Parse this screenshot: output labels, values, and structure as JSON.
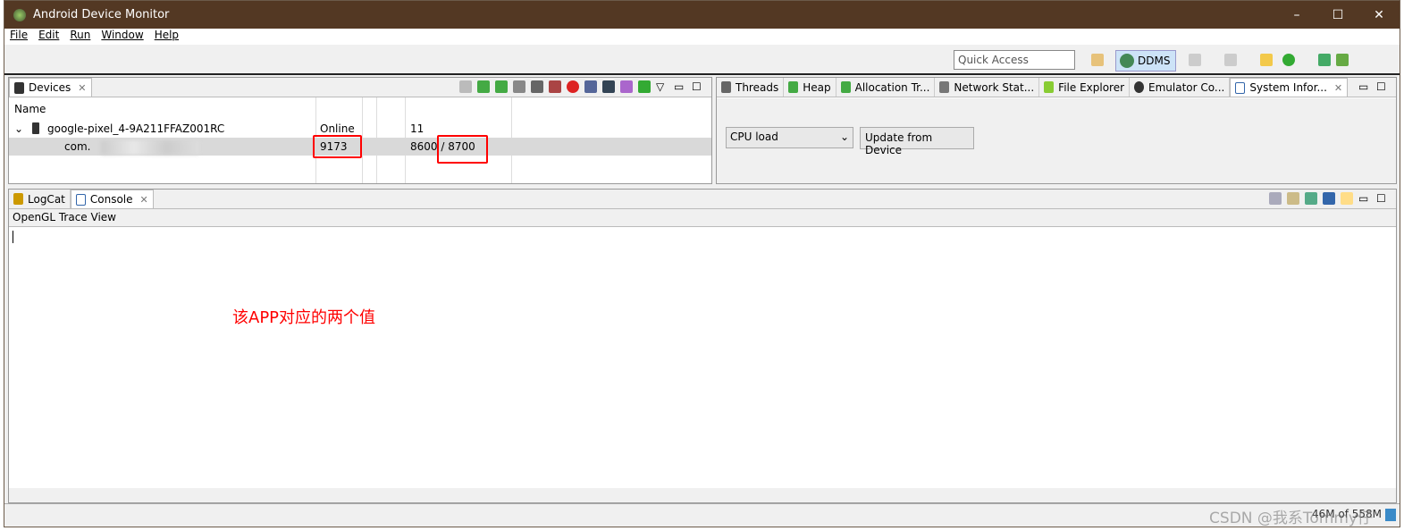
{
  "window": {
    "title": "Android Device Monitor",
    "controls": [
      "–",
      "☐",
      "✕"
    ]
  },
  "menu": [
    "File",
    "Edit",
    "Run",
    "Window",
    "Help"
  ],
  "toolbar": {
    "quick_access_placeholder": "Quick Access",
    "perspective": "DDMS"
  },
  "devices": {
    "tab": "Devices",
    "columns": {
      "name": "Name"
    },
    "device": {
      "name": "google-pixel_4-9A211FFAZ001RC",
      "status": "Online",
      "api": "11"
    },
    "process": {
      "name": "com.",
      "pid": "9173",
      "ports": "8600 / 8700"
    }
  },
  "right_tabs": [
    "Threads",
    "Heap",
    "Allocation Tr...",
    "Network Stat...",
    "File Explorer",
    "Emulator Co...",
    "System Infor..."
  ],
  "sysinfo": {
    "select": "CPU load",
    "button": "Update from Device"
  },
  "bottom_tabs": [
    "LogCat",
    "Console"
  ],
  "console": {
    "title": "OpenGL Trace View"
  },
  "annotation": "该APP对应的两个值",
  "status": {
    "memory": "46M of 558M",
    "watermark": "CSDN @我系Tommy仔"
  },
  "colors": {
    "titlebar": "#533823",
    "highlight": "#ff0000",
    "ddms": "#cde3f7"
  }
}
